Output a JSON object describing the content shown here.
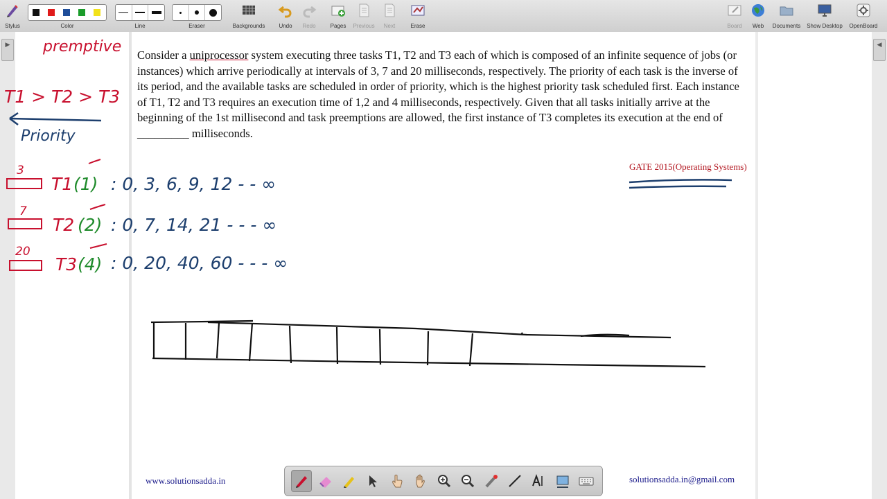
{
  "toolbar": {
    "stylus": "Stylus",
    "color": "Color",
    "line": "Line",
    "eraser": "Eraser",
    "backgrounds": "Backgrounds",
    "undo": "Undo",
    "redo": "Redo",
    "pages": "Pages",
    "previous": "Previous",
    "next": "Next",
    "erase": "Erase",
    "board": "Board",
    "web": "Web",
    "documents": "Documents",
    "show_desktop": "Show Desktop",
    "openboard": "OpenBoard"
  },
  "colors": {
    "palette": [
      "#111111",
      "#e01b1b",
      "#1f4e9a",
      "#1a9c2a",
      "#f2e21a"
    ],
    "ink_red": "#c8102e",
    "ink_blue": "#1d3f6e",
    "ink_green": "#1e8a2a",
    "ink_black": "#111111"
  },
  "question": {
    "pre": "Consider a ",
    "underlined": "uniprocessor",
    "post": " system executing three tasks T1, T2 and T3 each of which is composed of an infinite sequence of jobs (or instances) which arrive periodically at intervals of 3, 7 and 20 milliseconds, respectively. The priority of each task is the inverse of its period, and the available tasks are scheduled in order of priority, which is the highest priority task scheduled first. Each instance of T1, T2 and T3 requires an execution time of 1,2 and 4 milliseconds, respectively. Given that all tasks initially arrive at the beginning of the 1st millisecond and task preemptions are allowed, the first instance of T3 completes its execution at the end of _________ milliseconds."
  },
  "gate_label": "GATE 2015(Operating Systems)",
  "footer": {
    "website": "www.solutionsadda.in",
    "email": "solutionsadda.in@gmail.com"
  },
  "handwriting": {
    "preemptive": "premptive",
    "order": "T1 > T2 > T3",
    "priority": "Priority",
    "t1_period": "3",
    "t1": "T1",
    "t1_exec": "(1)",
    "t1_arrivals": ": 0, 3, 6, 9, 12 - - ∞",
    "t2_period": "7",
    "t2": "T2",
    "t2_exec": "(2)",
    "t2_arrivals": ": 0, 7, 14, 21 - - - ∞",
    "t3_period": "20",
    "t3": "T3",
    "t3_exec": "(4)",
    "t3_arrivals": ": 0, 20, 40, 60 - - - ∞"
  },
  "icons": {
    "stylus": "stylus-icon",
    "undo": "undo-icon",
    "redo": "redo-icon",
    "pages": "add-page-icon",
    "web": "globe-icon",
    "documents": "folder-icon",
    "show_desktop": "monitor-icon",
    "openboard": "gear-icon"
  }
}
